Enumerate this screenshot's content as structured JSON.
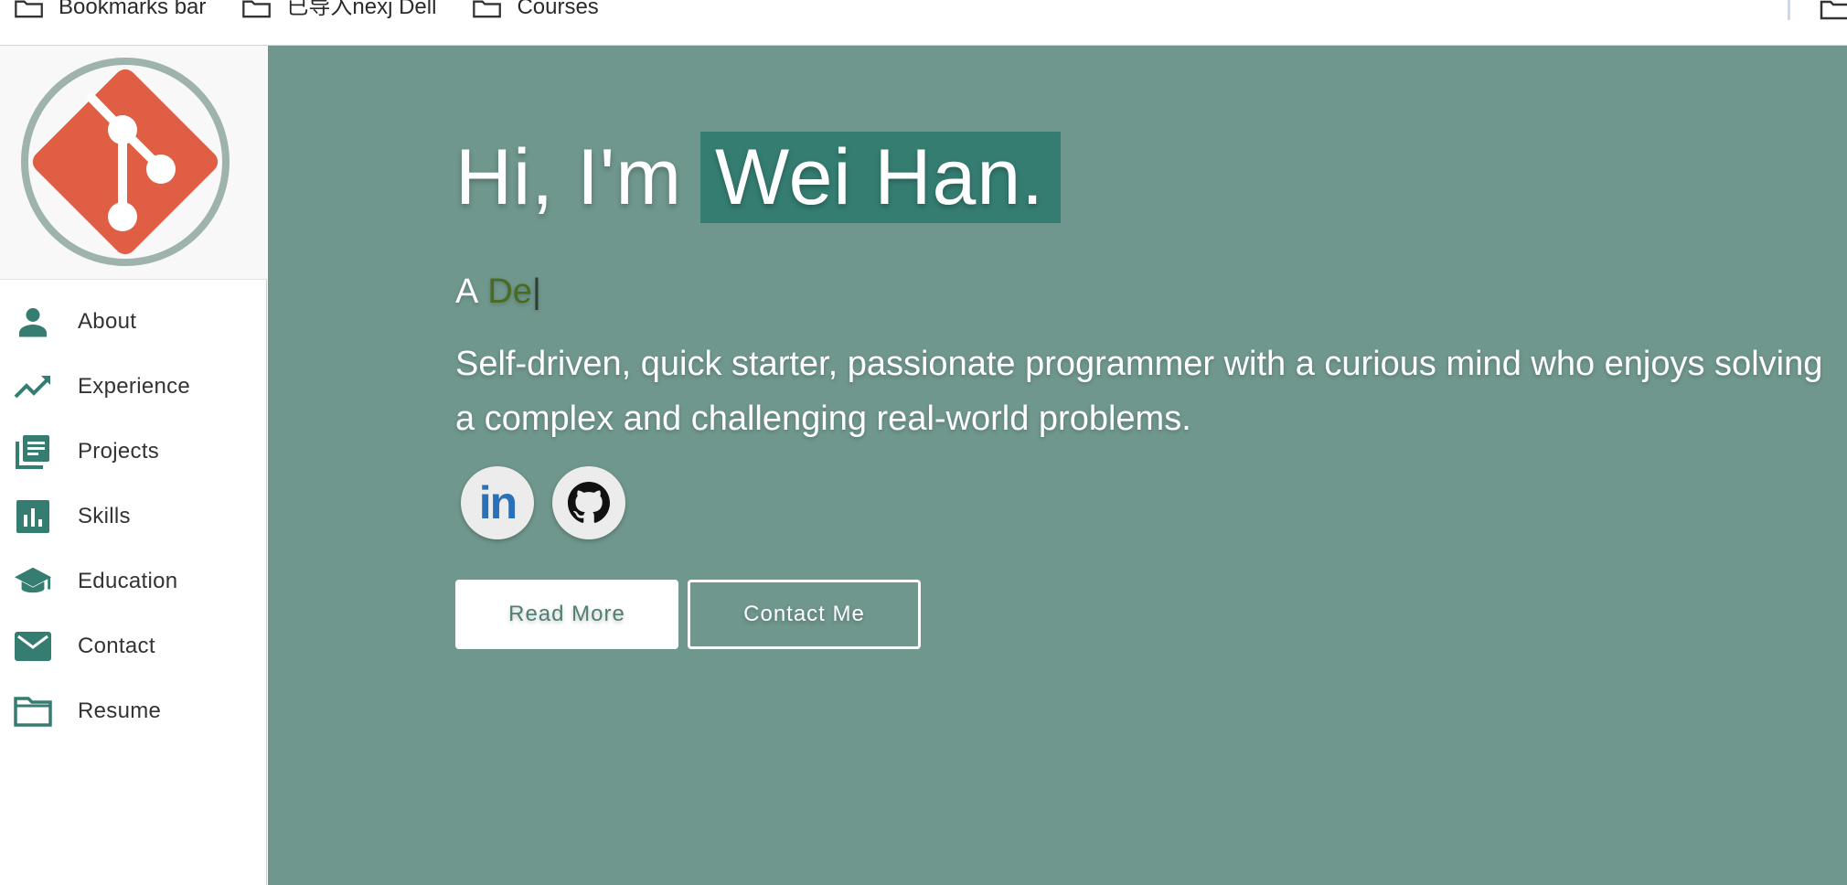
{
  "bookmarks": [
    {
      "label": "Bookmarks bar",
      "icon": "folder-icon"
    },
    {
      "label": "已导入nexj Dell",
      "icon": "folder-icon"
    },
    {
      "label": "Courses",
      "icon": "folder-icon"
    }
  ],
  "sidebar": {
    "logo": "git-logo",
    "items": [
      {
        "label": "About",
        "icon": "person-icon"
      },
      {
        "label": "Experience",
        "icon": "trending-up-icon"
      },
      {
        "label": "Projects",
        "icon": "library-books-icon"
      },
      {
        "label": "Skills",
        "icon": "bar-chart-icon"
      },
      {
        "label": "Education",
        "icon": "graduation-cap-icon"
      },
      {
        "label": "Contact",
        "icon": "mail-icon"
      },
      {
        "label": "Resume",
        "icon": "folder-icon"
      }
    ]
  },
  "hero": {
    "greeting_prefix": "Hi, I'm",
    "name": "Wei Han.",
    "role_prefix": "A",
    "role_typed": "De",
    "role_cursor": "|",
    "bio_line1": "Self-driven, quick starter, passionate programmer with a curious mind who enjoys solving",
    "bio_line2": "a complex and challenging real-world problems.",
    "read_more_label": "Read More",
    "contact_label": "Contact Me",
    "social": [
      {
        "name": "linkedin",
        "icon": "linkedin-icon",
        "text": "in"
      },
      {
        "name": "github",
        "icon": "github-icon"
      }
    ]
  },
  "colors": {
    "accent": "#357d71",
    "hero_bg": "#6f978d",
    "icon": "#357d71",
    "git_orange": "#e05e44"
  }
}
